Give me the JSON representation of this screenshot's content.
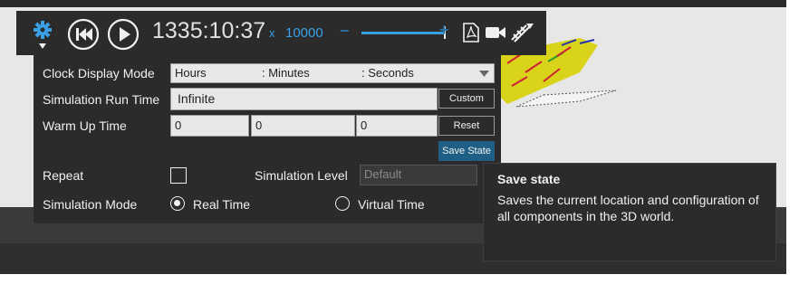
{
  "toolbar": {
    "time": "1335:10:37",
    "speed_prefix": "x",
    "speed": "10000",
    "minus": "−",
    "plus": "+",
    "slider_fraction": 0.99
  },
  "clock": {
    "label": "Clock Display Mode",
    "hours": "Hours",
    "minutes": ": Minutes",
    "seconds": ": Seconds"
  },
  "run": {
    "label": "Simulation Run Time",
    "value": "Infinite",
    "custom": "Custom"
  },
  "warm": {
    "label": "Warm Up Time",
    "v1": "0",
    "v2": "0",
    "v3": "0",
    "reset": "Reset"
  },
  "save_state": "Save State",
  "repeat": {
    "label": "Repeat"
  },
  "level": {
    "label": "Simulation Level",
    "value": "Default"
  },
  "mode": {
    "label": "Simulation Mode",
    "real": "Real Time",
    "virtual": "Virtual Time",
    "selected": "real"
  },
  "tooltip": {
    "title": "Save state",
    "body": "Saves the current location and configuration of all components in the 3D world."
  },
  "colors": {
    "accent": "#3aa0e6",
    "button_accent": "#1f5f85",
    "panel": "#2b2b2b"
  }
}
